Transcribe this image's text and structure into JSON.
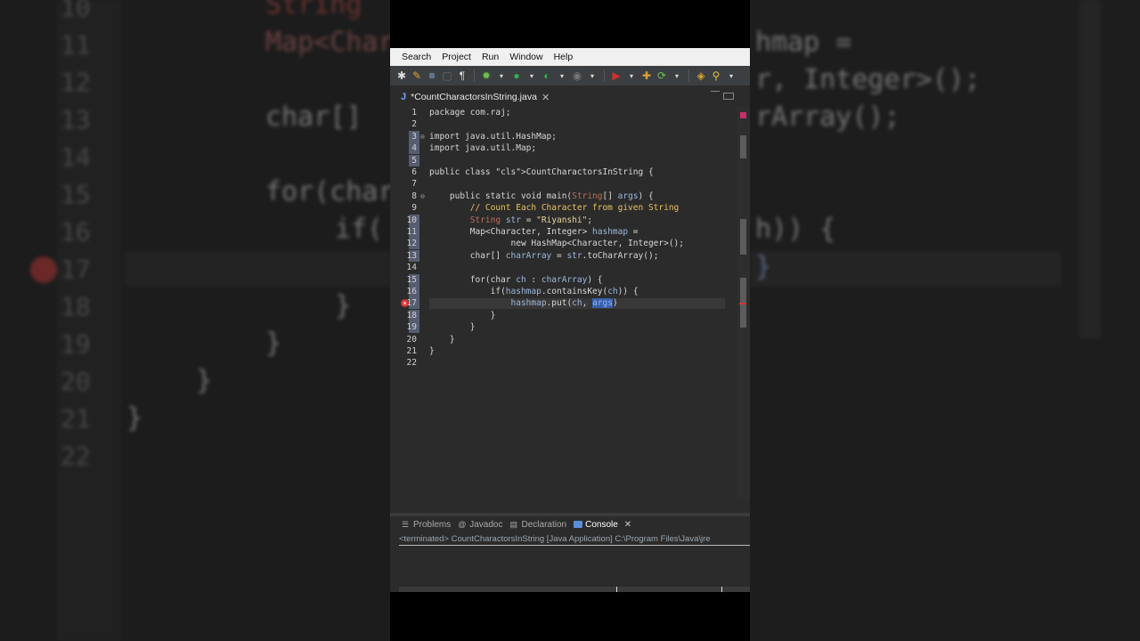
{
  "menu": {
    "items": [
      "Search",
      "Project",
      "Run",
      "Window",
      "Help"
    ]
  },
  "editor": {
    "tab_title": "*CountCharactorsInString.java",
    "lines": [
      {
        "n": "1",
        "html": "package com.raj;"
      },
      {
        "n": "2",
        "html": ""
      },
      {
        "n": "3",
        "html": "import java.util.HashMap;"
      },
      {
        "n": "4",
        "html": "import java.util.Map;"
      },
      {
        "n": "5",
        "html": ""
      },
      {
        "n": "6",
        "html": "public class CountCharactorsInString {"
      },
      {
        "n": "7",
        "html": ""
      },
      {
        "n": "8",
        "html": "    public static void main(String[] args) {"
      },
      {
        "n": "9",
        "html": "        // Count Each Character from given String"
      },
      {
        "n": "10",
        "html": "        String str = \"Riyanshi\";"
      },
      {
        "n": "11",
        "html": "        Map<Character, Integer> hashmap ="
      },
      {
        "n": "12",
        "html": "                new HashMap<Character, Integer>();"
      },
      {
        "n": "13",
        "html": "        char[] charArray = str.toCharArray();"
      },
      {
        "n": "14",
        "html": ""
      },
      {
        "n": "15",
        "html": "        for(char ch : charArray) {"
      },
      {
        "n": "16",
        "html": "            if(hashmap.containsKey(ch)) {"
      },
      {
        "n": "17",
        "html": "                hashmap.put(ch, args)"
      },
      {
        "n": "18",
        "html": "            }"
      },
      {
        "n": "19",
        "html": "        }"
      },
      {
        "n": "20",
        "html": "    }"
      },
      {
        "n": "21",
        "html": "}"
      },
      {
        "n": "22",
        "html": ""
      }
    ],
    "error_line": "17"
  },
  "panel": {
    "tabs": [
      "Problems",
      "Javadoc",
      "Declaration",
      "Console"
    ],
    "active_tab": "Console",
    "status": "<terminated> CountCharactorsInString [Java Application] C:\\Program Files\\Java\\jre"
  },
  "background": {
    "left_numbers": [
      "10",
      "11",
      "12",
      "13",
      "14",
      "15",
      "16",
      "17",
      "18",
      "19",
      "20",
      "21",
      "22"
    ],
    "left_code": [
      "String",
      "Map<Char",
      "char[]",
      "for(char",
      "if(",
      "}",
      "}",
      "}",
      "}"
    ],
    "right_code": [
      "hmap =",
      "r, Integer>();",
      "rArray();",
      "h)) {",
      "}"
    ]
  },
  "colors": {
    "editor_bg": "#2b2b2b",
    "menubar_bg": "#f0f0f0",
    "toolbar_bg": "#3c3f41",
    "error": "#d83030",
    "selection": "#3a5fa8"
  }
}
